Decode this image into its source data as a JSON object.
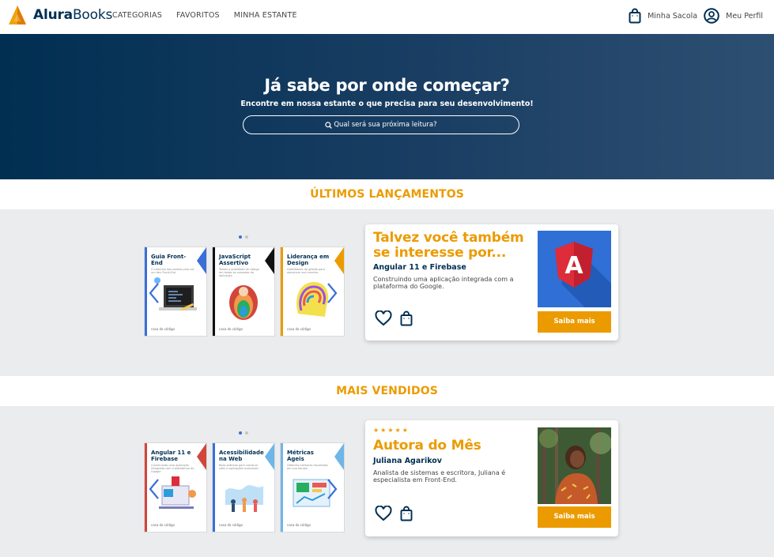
{
  "header": {
    "logo_bold": "Alura",
    "logo_light": "Books",
    "nav": [
      "CATEGORIAS",
      "FAVORITOS",
      "MINHA ESTANTE"
    ],
    "bag_label": "Minha Sacola",
    "profile_label": "Meu Perfil"
  },
  "hero": {
    "title": "Já sabe por onde começar?",
    "subtitle": "Encontre em nossa estante o que precisa para seu desenvolvimento!",
    "search_placeholder": "Qual será sua próxima leitura?"
  },
  "section1": {
    "title": "ÚLTIMOS LANÇAMENTOS",
    "books": [
      {
        "title": "Guia Front-End",
        "subtitle": "O caminho das pedras para ser um dev Front-End",
        "foot": "casa do código"
      },
      {
        "title": "JavaScript Assertivo",
        "subtitle": "Testes e qualidade de código em todas as camadas da aplicação",
        "foot": "casa do código"
      },
      {
        "title": "Liderança em Design",
        "subtitle": "Habilidades de gestão para alavancar sua carreira",
        "foot": "casa do código"
      }
    ],
    "card": {
      "title": "Talvez você também se interesse por...",
      "name": "Angular 11 e Firebase",
      "desc": "Construindo uma aplicação integrada com a plataforma do Google.",
      "button": "Saiba mais",
      "image_letter": "A"
    }
  },
  "section2": {
    "title": "MAIS VENDIDOS",
    "books": [
      {
        "title": "Angular 11 e Firebase",
        "subtitle": "Construindo uma aplicação integrada com a plataforma do Google",
        "foot": "casa do código"
      },
      {
        "title": "Acessibilidade na Web",
        "subtitle": "Boas práticas para construir sites e aplicações acessíveis",
        "foot": "casa do código"
      },
      {
        "title": "Métricas Ágeis",
        "subtitle": "Obtenha melhores resultados em sua equipe",
        "foot": "casa do código"
      }
    ],
    "card": {
      "stars": "★★★★★",
      "title": "Autora do Mês",
      "name": "Juliana Agarikov",
      "desc": "Analista de sistemas e escritora, Juliana é especialista em Front-End.",
      "button": "Saiba mais"
    }
  },
  "colors": {
    "navy": "#002f52",
    "orange": "#eb9b00",
    "band": "#ebecee"
  }
}
